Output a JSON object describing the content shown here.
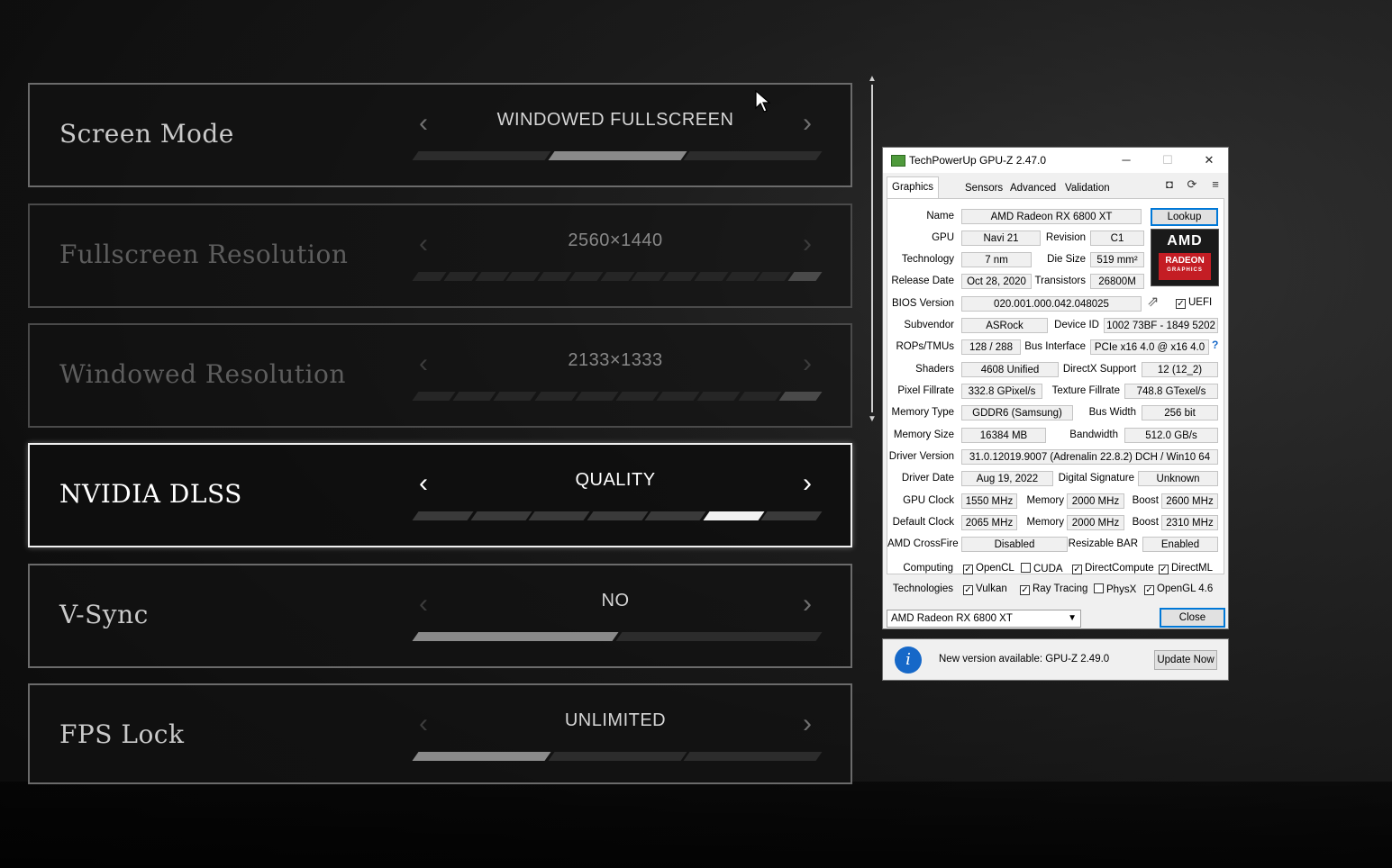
{
  "settings": [
    {
      "label": "Screen Mode",
      "value": "WINDOWED FULLSCREEN"
    },
    {
      "label": "Fullscreen Resolution",
      "value": "2560×1440"
    },
    {
      "label": "Windowed Resolution",
      "value": "2133×1333"
    },
    {
      "label": "NVIDIA DLSS",
      "value": "QUALITY"
    },
    {
      "label": "V-Sync",
      "value": "NO"
    },
    {
      "label": "FPS Lock",
      "value": "UNLIMITED"
    }
  ],
  "icons": {
    "left": "‹",
    "right": "›"
  },
  "gpuz": {
    "title": "TechPowerUp GPU-Z 2.47.0",
    "titlebar_buttons": {
      "minimize": "─",
      "maximize": "☐",
      "close": "✕"
    },
    "tabs": [
      "Graphics Card",
      "Sensors",
      "Advanced",
      "Validation"
    ],
    "tool_icons": {
      "camera": "◘",
      "refresh": "⟳",
      "menu": "≡"
    },
    "lookup_label": "Lookup",
    "labels": {
      "name": "Name",
      "gpu": "GPU",
      "revision": "Revision",
      "technology": "Technology",
      "die_size": "Die Size",
      "release_date": "Release Date",
      "transistors": "Transistors",
      "bios_version": "BIOS Version",
      "uefi": "UEFI",
      "subvendor": "Subvendor",
      "device_id": "Device ID",
      "rops_tmus": "ROPs/TMUs",
      "bus_interface": "Bus Interface",
      "shaders": "Shaders",
      "directx_support": "DirectX Support",
      "pixel_fillrate": "Pixel Fillrate",
      "texture_fillrate": "Texture Fillrate",
      "memory_type": "Memory Type",
      "bus_width": "Bus Width",
      "memory_size": "Memory Size",
      "bandwidth": "Bandwidth",
      "driver_version": "Driver Version",
      "driver_date": "Driver Date",
      "digital_signature": "Digital Signature",
      "gpu_clock": "GPU Clock",
      "memory": "Memory",
      "boost": "Boost",
      "default_clock": "Default Clock",
      "amd_crossfire": "AMD CrossFire",
      "resizable_bar": "Resizable BAR",
      "computing": "Computing",
      "technologies": "Technologies"
    },
    "values": {
      "name": "AMD Radeon RX 6800 XT",
      "gpu": "Navi 21",
      "revision": "C1",
      "technology": "7 nm",
      "die_size": "519 mm²",
      "release_date": "Oct 28, 2020",
      "transistors": "26800M",
      "bios_version": "020.001.000.042.048025",
      "subvendor": "ASRock",
      "device_id": "1002 73BF - 1849 5202",
      "rops_tmus": "128 / 288",
      "bus_interface": "PCIe x16 4.0 @ x16 4.0",
      "shaders": "4608 Unified",
      "directx_support": "12 (12_2)",
      "pixel_fillrate": "332.8 GPixel/s",
      "texture_fillrate": "748.8 GTexel/s",
      "memory_type": "GDDR6 (Samsung)",
      "bus_width": "256 bit",
      "memory_size": "16384 MB",
      "bandwidth": "512.0 GB/s",
      "driver_version": "31.0.12019.9007 (Adrenalin 22.8.2) DCH / Win10 64",
      "driver_date": "Aug 19, 2022",
      "digital_signature": "Unknown",
      "gpu_clock": "1550 MHz",
      "gpu_memory": "2000 MHz",
      "gpu_boost": "2600 MHz",
      "default_clock": "2065 MHz",
      "default_memory": "2000 MHz",
      "default_boost": "2310 MHz",
      "amd_crossfire": "Disabled",
      "resizable_bar": "Enabled"
    },
    "logo": {
      "amd": "AMD",
      "radeon": "RADEON",
      "graphics": "GRAPHICS"
    },
    "help_icon": "?",
    "share_icon": "⇗",
    "computing": [
      {
        "label": "OpenCL",
        "checked": true
      },
      {
        "label": "CUDA",
        "checked": false
      },
      {
        "label": "DirectCompute",
        "checked": true
      },
      {
        "label": "DirectML",
        "checked": true
      }
    ],
    "technologies": [
      {
        "label": "Vulkan",
        "checked": true
      },
      {
        "label": "Ray Tracing",
        "checked": true
      },
      {
        "label": "PhysX",
        "checked": false
      },
      {
        "label": "OpenGL 4.6",
        "checked": true
      }
    ],
    "selected_gpu": "AMD Radeon RX 6800 XT",
    "close_label": "Close"
  },
  "notice": {
    "icon": "i",
    "message": "New version available: GPU-Z 2.49.0",
    "button": "Update Now"
  }
}
